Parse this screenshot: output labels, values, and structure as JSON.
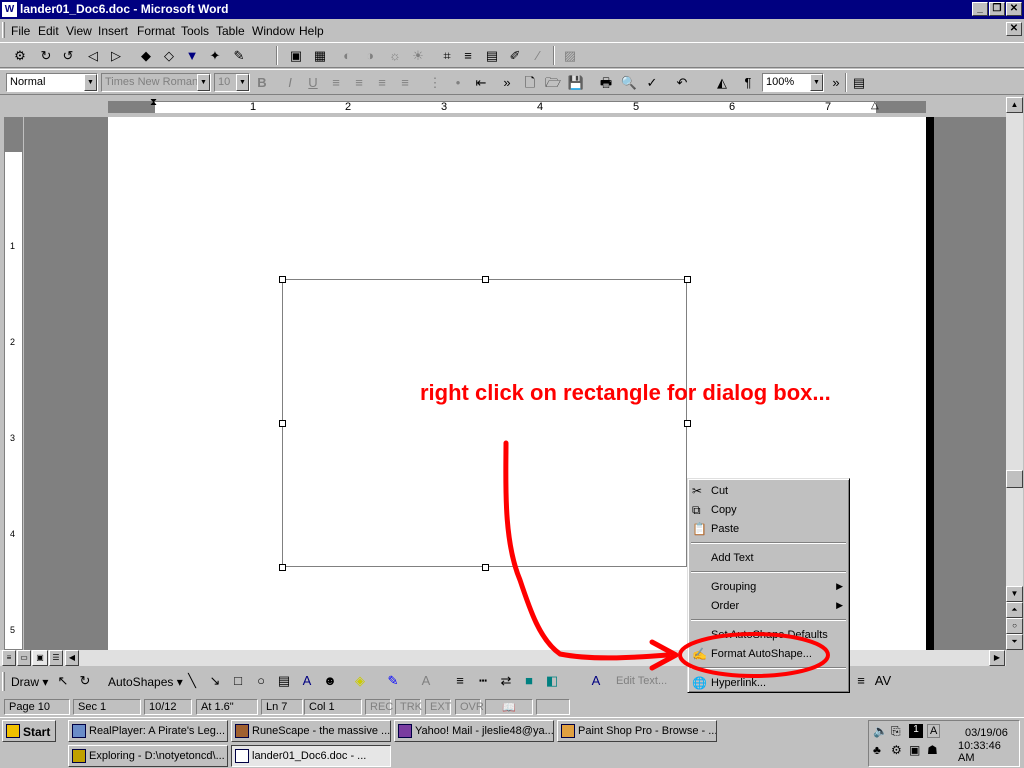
{
  "window": {
    "title": "lander01_Doc6.doc - Microsoft Word",
    "doc_icon": "W"
  },
  "menus": [
    "File",
    "Edit",
    "View",
    "Insert",
    "Format",
    "Tools",
    "Table",
    "Window",
    "Help"
  ],
  "formatting": {
    "style": "Normal",
    "font": "Times New Roman",
    "size": "10",
    "zoom": "100%"
  },
  "ruler": {
    "numbers": [
      "1",
      "2",
      "3",
      "4",
      "5",
      "6",
      "7"
    ]
  },
  "vruler": {
    "numbers": [
      "1",
      "2",
      "3",
      "4",
      "5"
    ]
  },
  "annotation": {
    "text": "right click on rectangle for dialog box...",
    "color": "#ff0000"
  },
  "context_menu": {
    "items": [
      {
        "label": "Cut",
        "icon": "scissors-icon"
      },
      {
        "label": "Copy",
        "icon": "copy-icon"
      },
      {
        "label": "Paste",
        "icon": "paste-icon"
      },
      {
        "label": "Add Text"
      },
      {
        "label": "Grouping",
        "submenu": true
      },
      {
        "label": "Order",
        "submenu": true
      },
      {
        "label": "Set AutoShape Defaults"
      },
      {
        "label": "Format AutoShape...",
        "icon": "format-autoshape-icon"
      },
      {
        "label": "Hyperlink...",
        "icon": "hyperlink-icon"
      }
    ]
  },
  "drawing": {
    "draw_label": "Draw",
    "autoshapes_label": "AutoShapes",
    "edit_text": "Edit Text..."
  },
  "status": {
    "page": "Page 10",
    "sec": "Sec 1",
    "pages": "10/12",
    "at": "At 1.6\"",
    "ln": "Ln 7",
    "col": "Col 1",
    "rec": "REC",
    "trk": "TRK",
    "ext": "EXT",
    "ovr": "OVR"
  },
  "taskbar": {
    "start": "Start",
    "tasks": [
      "RealPlayer: A Pirate's Leg...",
      "RuneScape - the massive ...",
      "Yahoo! Mail - jleslie48@ya...",
      "Paint Shop Pro - Browse - ...",
      "Exploring - D:\\notyetoncd\\...",
      "lander01_Doc6.doc - ..."
    ],
    "date": "03/19/06",
    "time": "10:33:46 AM",
    "tray_badge": "1"
  }
}
